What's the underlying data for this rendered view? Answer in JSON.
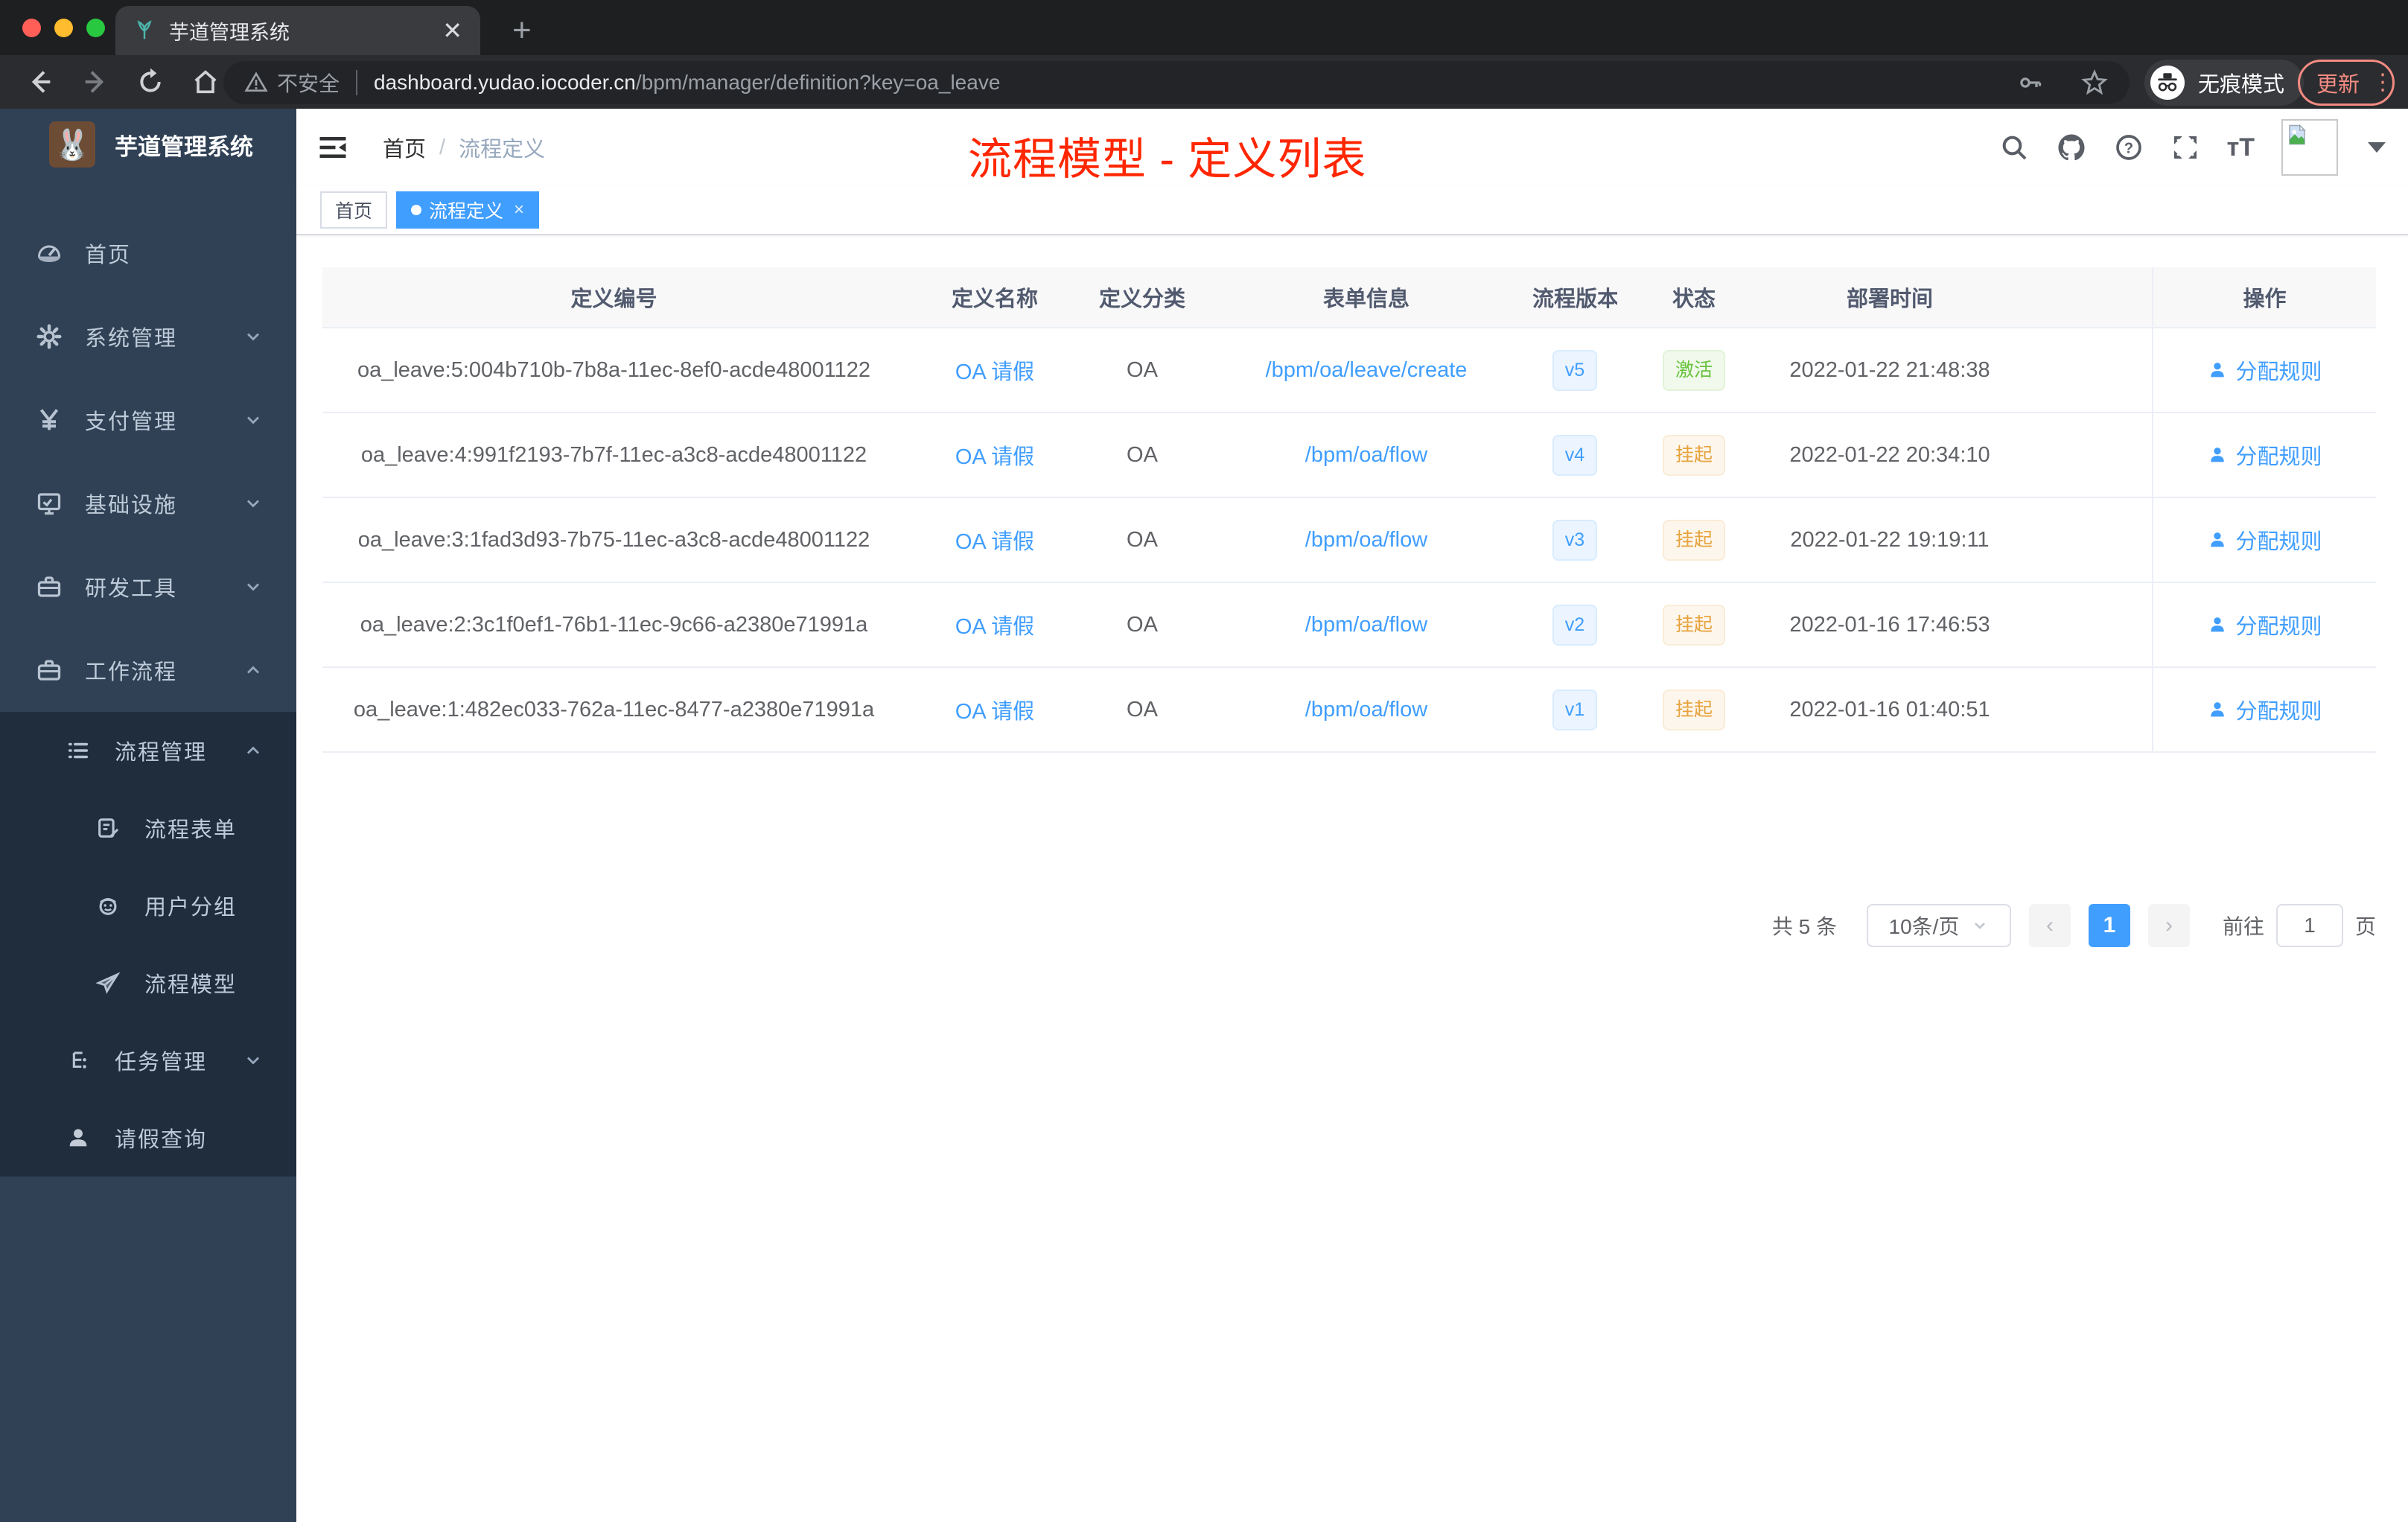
{
  "browser": {
    "tab_title": "芋道管理系统",
    "new_tab_label": "+",
    "close_tab_label": "✕",
    "security_label": "不安全",
    "url_domain": "dashboard.yudao.iocoder.cn",
    "url_path": "/bpm/manager/definition?key=oa_leave",
    "incognito_label": "无痕模式",
    "update_label": "更新",
    "menu_dots": "⋮"
  },
  "sidebar": {
    "logo_title": "芋道管理系统",
    "logo_emoji": "🐰",
    "items": [
      {
        "label": "首页",
        "icon": "dashboard-icon",
        "level": 0,
        "chevron": "none"
      },
      {
        "label": "系统管理",
        "icon": "gear-icon",
        "level": 0,
        "chevron": "down"
      },
      {
        "label": "支付管理",
        "icon": "yen-icon",
        "level": 0,
        "chevron": "down"
      },
      {
        "label": "基础设施",
        "icon": "monitor-icon",
        "level": 0,
        "chevron": "down"
      },
      {
        "label": "研发工具",
        "icon": "toolbox-icon",
        "level": 0,
        "chevron": "down"
      },
      {
        "label": "工作流程",
        "icon": "toolbox-icon",
        "level": 0,
        "chevron": "up"
      },
      {
        "label": "流程管理",
        "icon": "list-icon",
        "level": 1,
        "chevron": "up"
      },
      {
        "label": "流程表单",
        "icon": "form-edit-icon",
        "level": 2,
        "chevron": "none"
      },
      {
        "label": "用户分组",
        "icon": "robot-icon",
        "level": 2,
        "chevron": "none"
      },
      {
        "label": "流程模型",
        "icon": "paper-plane-icon",
        "level": 2,
        "chevron": "none"
      },
      {
        "label": "任务管理",
        "icon": "flow-tree-icon",
        "level": 1,
        "chevron": "down"
      },
      {
        "label": "请假查询",
        "icon": "user-icon",
        "level": 1,
        "chevron": "none"
      }
    ]
  },
  "navbar": {
    "breadcrumb": {
      "home": "首页",
      "separator": "/",
      "current": "流程定义"
    },
    "icons": [
      "search-icon",
      "github-icon",
      "help-icon",
      "fullscreen-icon",
      "font-size-icon",
      "avatar-broken-image",
      "caret-down-icon"
    ]
  },
  "annotation": "流程模型 - 定义列表",
  "tags_view": {
    "tags": [
      {
        "label": "首页",
        "active": false
      },
      {
        "label": "流程定义",
        "active": true,
        "close": "×"
      }
    ]
  },
  "table": {
    "columns": {
      "id": "定义编号",
      "name": "定义名称",
      "category": "定义分类",
      "form": "表单信息",
      "version": "流程版本",
      "status": "状态",
      "deploy_time": "部署时间",
      "operation": "操作"
    },
    "rows": [
      {
        "id": "oa_leave:5:004b710b-7b8a-11ec-8ef0-acde48001122",
        "name": "OA 请假",
        "category": "OA",
        "form": "/bpm/oa/leave/create",
        "version": "v5",
        "status": "激活",
        "deploy_time": "2022-01-22 21:48:38",
        "action": "分配规则"
      },
      {
        "id": "oa_leave:4:991f2193-7b7f-11ec-a3c8-acde48001122",
        "name": "OA 请假",
        "category": "OA",
        "form": "/bpm/oa/flow",
        "version": "v4",
        "status": "挂起",
        "deploy_time": "2022-01-22 20:34:10",
        "action": "分配规则"
      },
      {
        "id": "oa_leave:3:1fad3d93-7b75-11ec-a3c8-acde48001122",
        "name": "OA 请假",
        "category": "OA",
        "form": "/bpm/oa/flow",
        "version": "v3",
        "status": "挂起",
        "deploy_time": "2022-01-22 19:19:11",
        "action": "分配规则"
      },
      {
        "id": "oa_leave:2:3c1f0ef1-76b1-11ec-9c66-a2380e71991a",
        "name": "OA 请假",
        "category": "OA",
        "form": "/bpm/oa/flow",
        "version": "v2",
        "status": "挂起",
        "deploy_time": "2022-01-16 17:46:53",
        "action": "分配规则"
      },
      {
        "id": "oa_leave:1:482ec033-762a-11ec-8477-a2380e71991a",
        "name": "OA 请假",
        "category": "OA",
        "form": "/bpm/oa/flow",
        "version": "v1",
        "status": "挂起",
        "deploy_time": "2022-01-16 01:40:51",
        "action": "分配规则"
      }
    ]
  },
  "pagination": {
    "total_label": "共 5 条",
    "page_size": "10条/页",
    "prev": "‹",
    "current_page": "1",
    "next": "›",
    "goto_label": "前往",
    "goto_value": "1",
    "page_unit": "页"
  },
  "colors": {
    "accent": "#409EFF",
    "success": "#67C23A",
    "warning": "#E6A23C",
    "annotation_red": "#FF2600",
    "sidebar_bg": "#304156",
    "submenu_bg": "#1F2D3D",
    "chrome_dark": "#1E1F21"
  }
}
